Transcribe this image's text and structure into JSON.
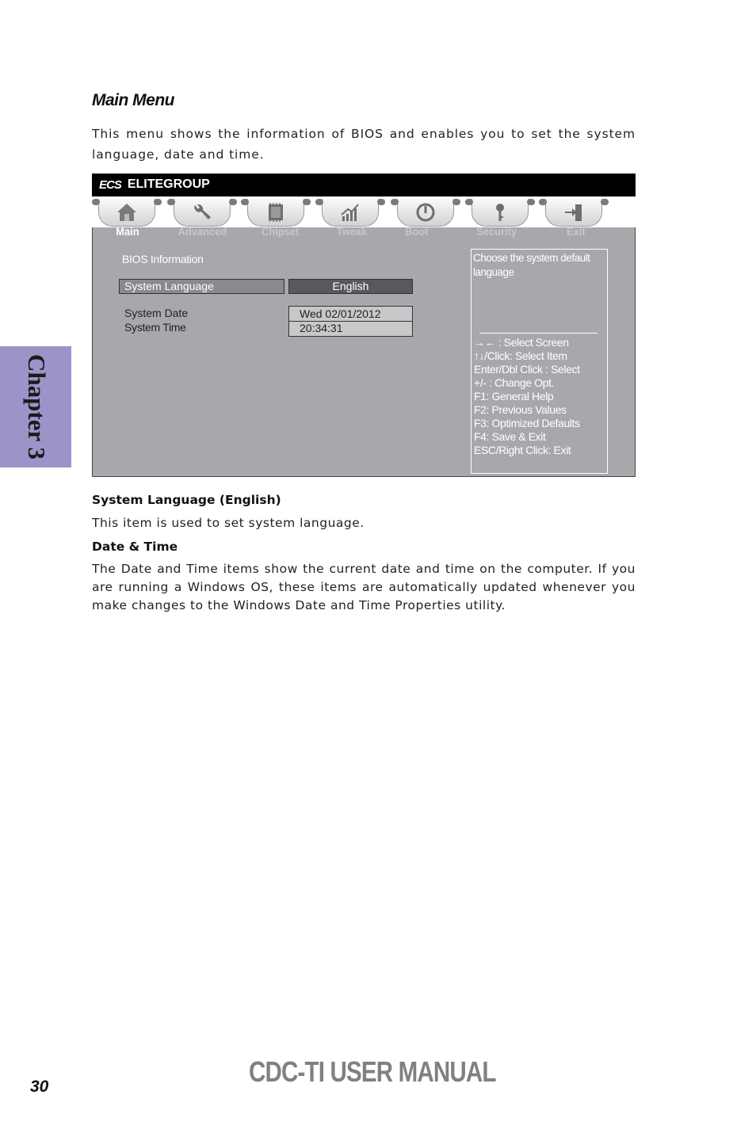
{
  "section": {
    "title": "Main Menu",
    "intro": "This menu shows the information of BIOS and enables you to set the system language, date and time."
  },
  "bios": {
    "logo_mark": "ECS",
    "brand": "ELITEGROUP",
    "tabs": [
      {
        "label": "Main",
        "icon": "home-icon",
        "active": true
      },
      {
        "label": "Advanced",
        "icon": "wrench-icon",
        "active": false
      },
      {
        "label": "Chipset",
        "icon": "chip-icon",
        "active": false
      },
      {
        "label": "Tweak",
        "icon": "chart-icon",
        "active": false
      },
      {
        "label": "Boot",
        "icon": "power-icon",
        "active": false
      },
      {
        "label": "Security",
        "icon": "key-icon",
        "active": false
      },
      {
        "label": "Exit",
        "icon": "exit-door-icon",
        "active": false
      }
    ],
    "bios_info_label": "BIOS Information",
    "system_language": {
      "label": "System  Language",
      "value": "English"
    },
    "system_date": {
      "label": "System Date",
      "value": "Wed 02/01/2012"
    },
    "system_time": {
      "label": "System Time",
      "value": "20:34:31"
    },
    "help": {
      "description": "Choose the system default language",
      "keys": [
        "→←    : Select Screen",
        "↑↓/Click: Select Item",
        "Enter/Dbl Click : Select",
        "+/- : Change Opt.",
        "F1: General Help",
        "F2: Previous Values",
        "F3: Optimized Defaults",
        "F4: Save & Exit",
        "ESC/Right Click: Exit"
      ]
    },
    "colors": {
      "header_bg": "#000000",
      "body_bg": "#a7a8ab",
      "selected_value_bg": "#59595b"
    }
  },
  "items": [
    {
      "heading": "System Language (English)",
      "text": "This item is used to set system language."
    },
    {
      "heading": "Date & Time",
      "text": "The Date and Time items show the current date and time on the computer. If you are running a Windows OS, these items are automatically updated whenever you make changes to the Windows Date and Time Properties utility."
    }
  ],
  "chapter_tab": {
    "label": "Chapter 3",
    "color": "#9b94c8"
  },
  "footer": {
    "page_number": "30",
    "title": "CDC-TI USER MANUAL"
  }
}
